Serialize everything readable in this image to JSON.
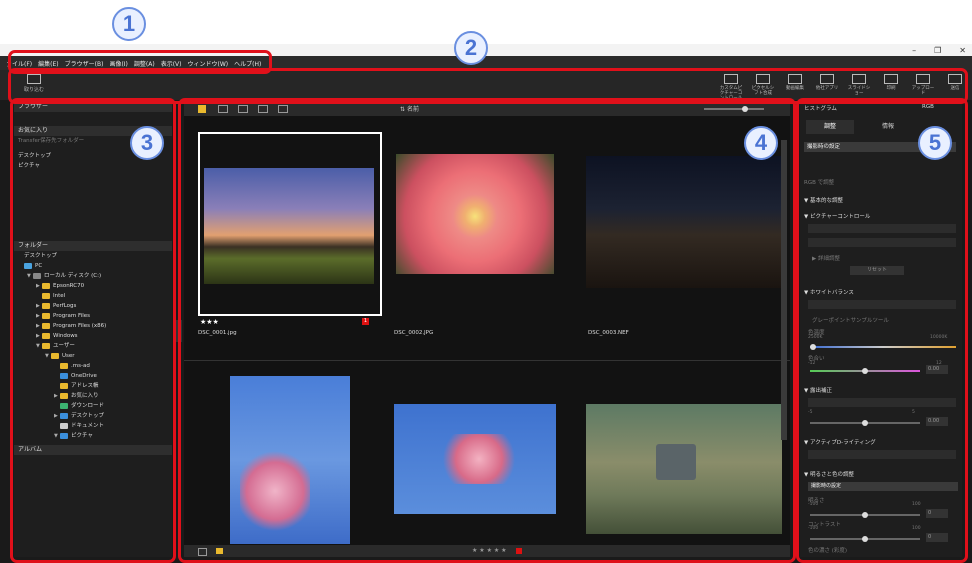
{
  "callouts": [
    "1",
    "2",
    "3",
    "4",
    "5"
  ],
  "window": {
    "minimize": "–",
    "maximize": "❐",
    "close": "✕"
  },
  "menu": [
    "ァイル(F)",
    "編集(E)",
    "ブラウザー(B)",
    "画像(I)",
    "調整(A)",
    "表示(V)",
    "ウィンドウ(W)",
    "ヘルプ(H)"
  ],
  "toolbar": {
    "import": "取り込む",
    "right": [
      "カスタムピクチャーコントロール",
      "ピクセルシフト合成",
      "動画編集",
      "他社アプリ",
      "スライドショー",
      "印刷",
      "アップロード",
      "送信"
    ]
  },
  "left": {
    "header": "ブラウザー",
    "favorites_header": "お気に入り",
    "transfer": "Transfer保存先フォルダー",
    "fav_items": [
      "デスクトップ",
      "ピクチャ"
    ],
    "folders_header": "フォルダー",
    "tree": [
      {
        "label": "デスクトップ",
        "indent": 0,
        "arrow": "",
        "icon": "none"
      },
      {
        "label": "PC",
        "indent": 0,
        "arrow": "",
        "icon": "pc"
      },
      {
        "label": "ローカル ディスク (C:)",
        "indent": 1,
        "arrow": "▼",
        "icon": "disk"
      },
      {
        "label": "EpsonRC70",
        "indent": 2,
        "arrow": "▶",
        "icon": "folder"
      },
      {
        "label": "Intel",
        "indent": 2,
        "arrow": "",
        "icon": "folder"
      },
      {
        "label": "PerfLogs",
        "indent": 2,
        "arrow": "▶",
        "icon": "folder"
      },
      {
        "label": "Program Files",
        "indent": 2,
        "arrow": "▶",
        "icon": "folder"
      },
      {
        "label": "Program Files (x86)",
        "indent": 2,
        "arrow": "▶",
        "icon": "folder"
      },
      {
        "label": "Windows",
        "indent": 2,
        "arrow": "▶",
        "icon": "folder"
      },
      {
        "label": "ユーザー",
        "indent": 2,
        "arrow": "▼",
        "icon": "folder"
      },
      {
        "label": "User",
        "indent": 3,
        "arrow": "▼",
        "icon": "folder"
      },
      {
        "label": ".ms-ad",
        "indent": 4,
        "arrow": "",
        "icon": "folder"
      },
      {
        "label": "OneDrive",
        "indent": 4,
        "arrow": "",
        "icon": "cloud"
      },
      {
        "label": "アドレス帳",
        "indent": 4,
        "arrow": "",
        "icon": "folder"
      },
      {
        "label": "お気に入り",
        "indent": 4,
        "arrow": "▶",
        "icon": "folder"
      },
      {
        "label": "ダウンロード",
        "indent": 4,
        "arrow": "",
        "icon": "download"
      },
      {
        "label": "デスクトップ",
        "indent": 4,
        "arrow": "▶",
        "icon": "desktop"
      },
      {
        "label": "ドキュメント",
        "indent": 4,
        "arrow": "",
        "icon": "doc"
      },
      {
        "label": "ピクチャ",
        "indent": 4,
        "arrow": "▼",
        "icon": "pic"
      }
    ],
    "album_header": "アルバム"
  },
  "content": {
    "sort_label": "名前",
    "thumbs": [
      {
        "file": "DSC_0001.jpg",
        "rating": "★★★",
        "tag": "1",
        "selected": true
      },
      {
        "file": "DSC_0002.JPG",
        "rating": "",
        "tag": "",
        "selected": false
      },
      {
        "file": "DSC_0003.NEF",
        "rating": "",
        "tag": "",
        "selected": false
      },
      {
        "file": "",
        "rating": "",
        "tag": "",
        "selected": false
      },
      {
        "file": "",
        "rating": "",
        "tag": "",
        "selected": false
      },
      {
        "file": "",
        "rating": "",
        "tag": "",
        "selected": false
      }
    ]
  },
  "right": {
    "header": "ヒストグラム",
    "rgb": "RGB",
    "tab_adjust": "調整",
    "tab_info": "情報",
    "preset": "撮影時の設定",
    "rgb_adjust": "RGB で調整",
    "basic": "基本的な調整",
    "picture_control": "ピクチャーコントロール",
    "detail": "詳細調整",
    "reset": "リセット",
    "white_balance": "ホワイトバランス",
    "gray_point": "グレーポイントサンプルツール",
    "color_temp": "色温度",
    "temp_min": "2500K",
    "temp_max": "10000K",
    "tint": "色合い",
    "tint_min": "-12",
    "tint_max": "12",
    "tint_val": "0.00",
    "exposure": "露出補正",
    "exp_min": "-5",
    "exp_max": "5",
    "exp_val": "0.00",
    "adl": "アクティブD-ライティング",
    "brightness_section": "明るさと色の調整",
    "brightness_preset": "撮影時の設定",
    "brightness": "明るさ",
    "contrast": "コントラスト",
    "saturation": "色の濃さ (彩度)",
    "minus100": "-100",
    "plus100": "100",
    "zero": "0"
  },
  "colors": {
    "red": "#e0101a",
    "callout": "#4a73d3"
  }
}
